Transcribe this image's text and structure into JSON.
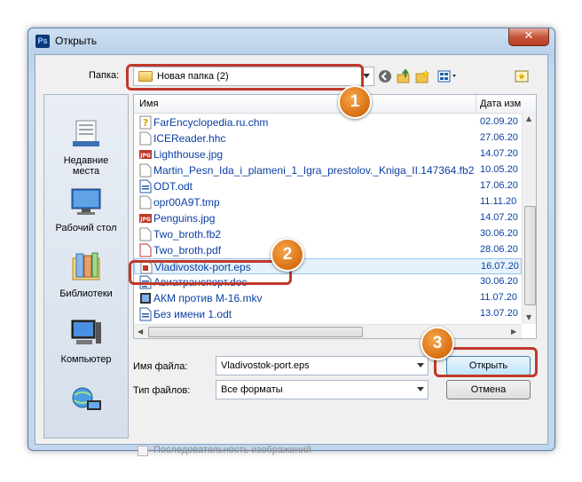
{
  "window": {
    "app_icon": "Ps",
    "title": "Открыть",
    "close_glyph": "✕"
  },
  "toolbar": {
    "folder_label": "Папка:",
    "folder_value": "Новая папка (2)",
    "icons": [
      "back-icon",
      "up-folder-icon",
      "new-folder-icon",
      "views-menu-icon",
      "desktop-icon"
    ]
  },
  "places": [
    {
      "label_line1": "Недавние",
      "label_line2": "места",
      "icon": "recent-places-icon"
    },
    {
      "label_line1": "Рабочий стол",
      "label_line2": "",
      "icon": "desktop-icon"
    },
    {
      "label_line1": "Библиотеки",
      "label_line2": "",
      "icon": "libraries-icon"
    },
    {
      "label_line1": "Компьютер",
      "label_line2": "",
      "icon": "computer-icon"
    },
    {
      "label_line1": "",
      "label_line2": "",
      "icon": "network-icon"
    }
  ],
  "list": {
    "columns": {
      "name": "Имя",
      "date": "Дата изм"
    },
    "rows": [
      {
        "name": "FarEncyclopedia.ru.chm",
        "date": "02.09.20",
        "icon": "chm-icon"
      },
      {
        "name": "ICEReader.hhc",
        "date": "27.06.20",
        "icon": "file-icon"
      },
      {
        "name": "Lighthouse.jpg",
        "date": "14.07.20",
        "icon": "jpg-icon"
      },
      {
        "name": "Martin_Pesn_Ida_i_plameni_1_Igra_prestolov._Kniga_II.147364.fb2",
        "date": "10.05.20",
        "icon": "file-icon"
      },
      {
        "name": "ODT.odt",
        "date": "17.06.20",
        "icon": "odt-icon"
      },
      {
        "name": "opr00A9T.tmp",
        "date": "11.11.20",
        "icon": "file-icon"
      },
      {
        "name": "Penguins.jpg",
        "date": "14.07.20",
        "icon": "jpg-icon"
      },
      {
        "name": "Two_broth.fb2",
        "date": "30.06.20",
        "icon": "file-icon"
      },
      {
        "name": "Two_broth.pdf",
        "date": "28.06.20",
        "icon": "pdf-icon"
      },
      {
        "name": "Vladivostok-port.eps",
        "date": "16.07.20",
        "icon": "eps-icon"
      },
      {
        "name": "Авиатранспорт.doc",
        "date": "30.06.20",
        "icon": "doc-icon"
      },
      {
        "name": "АКМ против М-16.mkv",
        "date": "11.07.20",
        "icon": "video-icon"
      },
      {
        "name": "Без имени 1.odt",
        "date": "13.07.20",
        "icon": "odt-icon"
      }
    ],
    "selected_index": 9
  },
  "form": {
    "filename_label": "Имя файла:",
    "filename_value": "Vladivostok-port.eps",
    "filetype_label": "Тип файлов:",
    "filetype_value": "Все форматы",
    "open_button": "Открыть",
    "cancel_button": "Отмена",
    "sequence_checkbox": "Последовательность изображений"
  },
  "callouts": [
    "1",
    "2",
    "3"
  ],
  "colors": {
    "callout_border": "#c0392b",
    "callout_badge": "#e07a1b",
    "file_text": "#0a3fa3"
  }
}
